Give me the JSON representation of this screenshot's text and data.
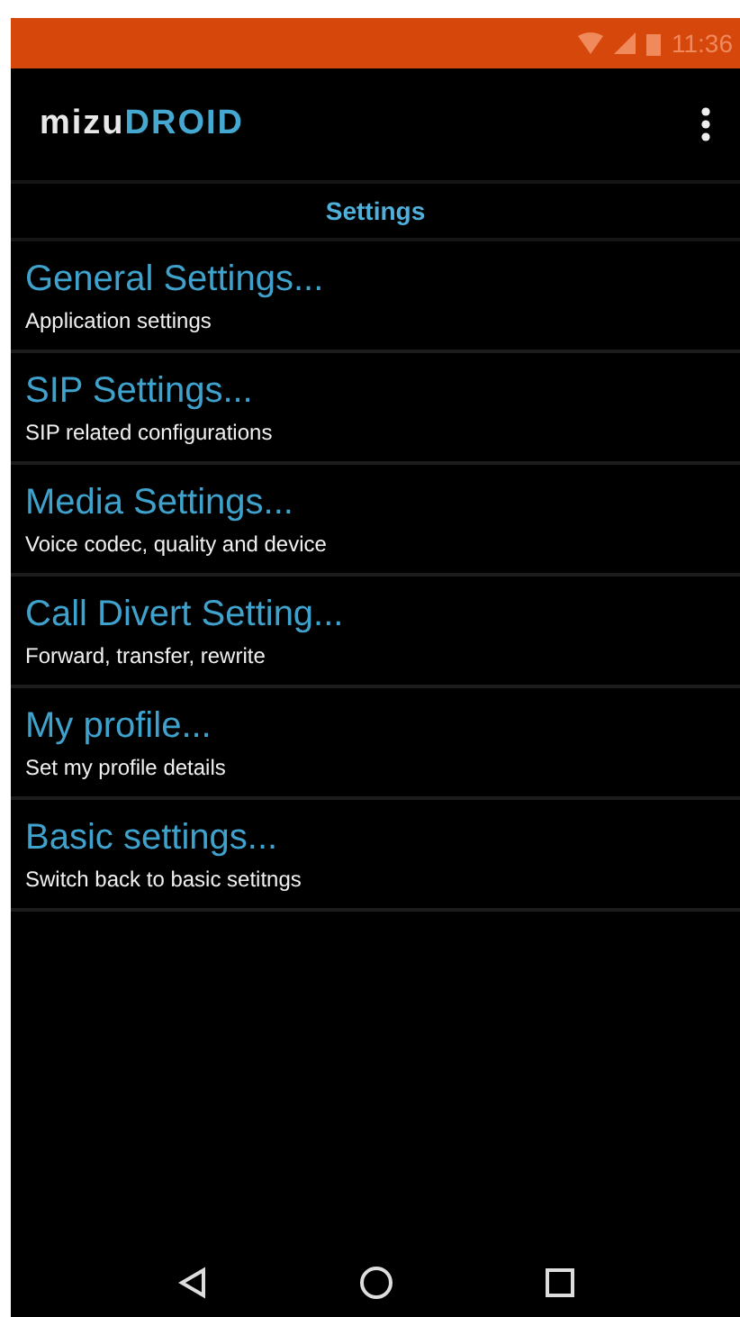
{
  "status_bar": {
    "time": "11:36"
  },
  "app_bar": {
    "logo_left": "mizu",
    "logo_right": "DROID"
  },
  "section_title": "Settings",
  "items": [
    {
      "title": "General Settings...",
      "summary": "Application settings"
    },
    {
      "title": "SIP Settings...",
      "summary": "SIP related configurations"
    },
    {
      "title": "Media Settings...",
      "summary": "Voice codec, quality and device"
    },
    {
      "title": "Call Divert Setting...",
      "summary": "Forward, transfer, rewrite"
    },
    {
      "title": "My profile...",
      "summary": "Set my profile details"
    },
    {
      "title": "Basic settings...",
      "summary": "Switch back to basic setitngs"
    }
  ]
}
